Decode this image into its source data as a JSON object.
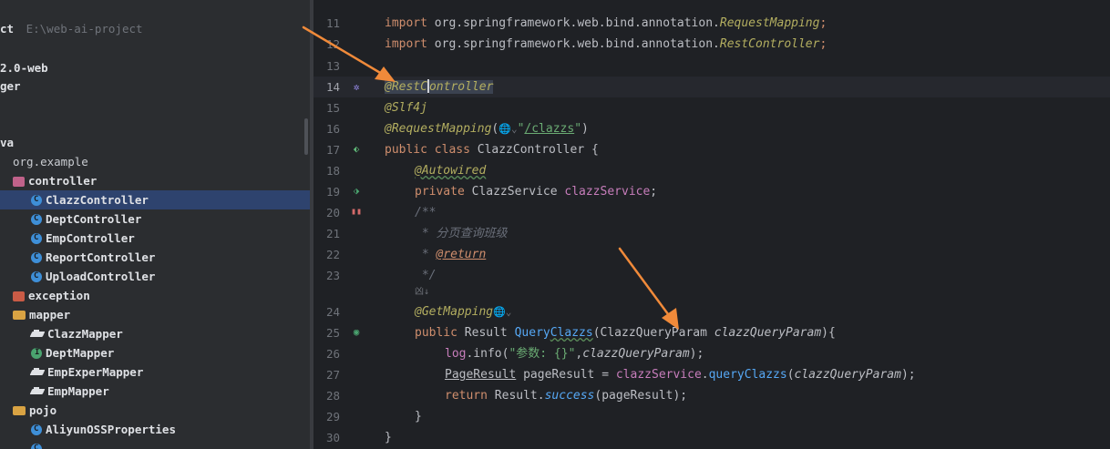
{
  "tabs": [
    {
      "label": "...",
      "active": false
    },
    {
      "label": "...",
      "active": false
    },
    {
      "label": "...",
      "active": false
    },
    {
      "label": "...",
      "active": false
    },
    {
      "label": "...",
      "active": true
    }
  ],
  "project": {
    "label": "ct",
    "path": "E:\\web-ai-project",
    "version": "2.0-web",
    "ger": "ger",
    "va": "va"
  },
  "tree": [
    {
      "label": "org.example",
      "type": "none",
      "indent": 14,
      "bold": false
    },
    {
      "label": "controller",
      "type": "pkg-ctrl",
      "indent": 14
    },
    {
      "label": "ClazzController",
      "type": "class",
      "indent": 34,
      "selected": true
    },
    {
      "label": "DeptController",
      "type": "class",
      "indent": 34
    },
    {
      "label": "EmpController",
      "type": "class",
      "indent": 34
    },
    {
      "label": "ReportController",
      "type": "class",
      "indent": 34
    },
    {
      "label": "UploadController",
      "type": "class",
      "indent": 34
    },
    {
      "label": "exception",
      "type": "pkg-ex",
      "indent": 14
    },
    {
      "label": "mapper",
      "type": "folder",
      "indent": 14
    },
    {
      "label": "ClazzMapper",
      "type": "mapper",
      "indent": 34
    },
    {
      "label": "DeptMapper",
      "type": "iface",
      "indent": 34
    },
    {
      "label": "EmpExperMapper",
      "type": "mapper",
      "indent": 34
    },
    {
      "label": "EmpMapper",
      "type": "mapper",
      "indent": 34
    },
    {
      "label": "pojo",
      "type": "folder",
      "indent": 14
    },
    {
      "label": "AliyunOSSProperties",
      "type": "class",
      "indent": 34
    }
  ],
  "editor": {
    "line_numbers": [
      "11",
      "12",
      "13",
      "14",
      "15",
      "16",
      "17",
      "18",
      "19",
      "20",
      "21",
      "22",
      "23",
      "",
      "24",
      "25",
      "26",
      "27",
      "28",
      "29",
      "30"
    ],
    "current_line": "14",
    "code": {
      "l11_kw": "import",
      "l11_pkg": " org.springframework.web.bind.annotation.",
      "l11_cls": "RequestMapping",
      "l11_end": ";",
      "l12_kw": "import",
      "l12_pkg": " org.springframework.web.bind.annotation.",
      "l12_cls": "RestController",
      "l12_end": ";",
      "l14_a": "@RestC",
      "l14_b": "ontroller",
      "l15": "@Slf4j",
      "l16_ann": "@RequestMapping",
      "l16_open": "(",
      "l16_globe": "🌐",
      "l16_glyph": "⌄",
      "l16_q1": "\"",
      "l16_path": "/clazzs",
      "l16_q2": "\"",
      "l16_close": ")",
      "l17_kw": "public class ",
      "l17_name": "ClazzController {",
      "l18": "@Autowired",
      "l19_kw": "private ",
      "l19_rest": "ClazzService ",
      "l19_field": "clazzService",
      "l19_end": ";",
      "l20": "/**",
      "l21": " * 分页查询班级",
      "l22_star": " * ",
      "l22_tag": "@return",
      "l23": " */",
      "lx": "凶↓",
      "l24_ann": "@GetMapping",
      "l24_globe": "🌐",
      "l24_glyph": "⌄",
      "l25_kw": "public ",
      "l25_type": "Result ",
      "l25_fn1": "Query",
      "l25_fn2": "Clazzs",
      "l25_open": "(",
      "l25_ptype": "ClazzQueryParam ",
      "l25_pname": "clazzQueryParam",
      "l25_close": "){",
      "l26_log": "log",
      "l26_dot": ".info(",
      "l26_str": "\"参数: {}\"",
      "l26_comma": ",",
      "l26_arg": "clazzQueryParam",
      "l26_end": ");",
      "l27_type": "PageResult",
      "l27_var": " pageResult = ",
      "l27_field": "clazzService",
      "l27_dot": ".",
      "l27_fn": "queryClazzs",
      "l27_open": "(",
      "l27_arg": "clazzQueryParam",
      "l27_end": ");",
      "l28_kw": "return ",
      "l28_cls": "Result.",
      "l28_fn": "success",
      "l28_end": "(pageResult);",
      "l29": "}",
      "l30": "}"
    }
  },
  "colors": {
    "arrow": "#f08a3a",
    "selection": "#2e436e",
    "editor_bg": "#1f2125",
    "sidebar_bg": "#2b2d30"
  }
}
